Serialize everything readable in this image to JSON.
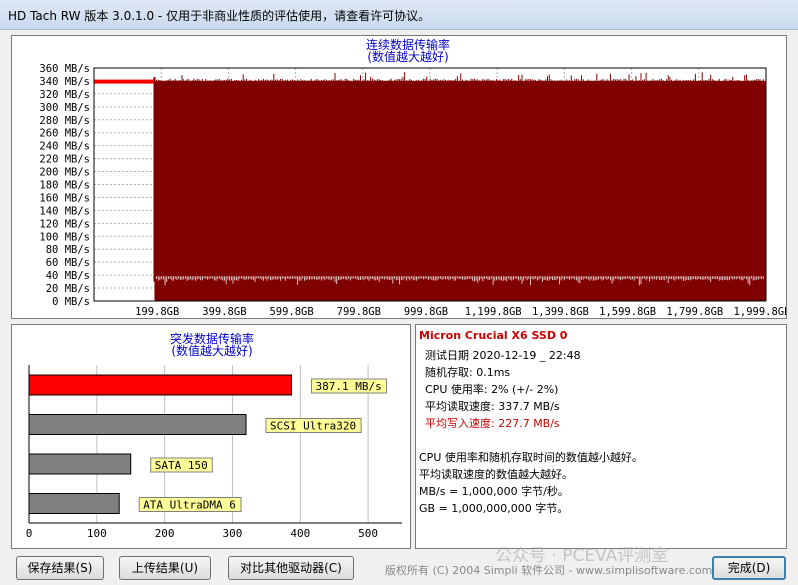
{
  "window": {
    "title": "HD Tach RW 版本 3.0.1.0  - 仅用于非商业性质的评估使用，请查看许可协议。"
  },
  "seq_chart": {
    "title_line1": "连续数据传输率",
    "title_line2": "(数值越大越好)"
  },
  "burst_chart": {
    "title_line1": "突发数据传输率",
    "title_line2": "(数值越大越好)"
  },
  "info": {
    "drive_name": "Micron Crucial X6 SSD 0",
    "test_date": "测试日期 2020-12-19 _ 22:48",
    "random_access": "随机存取: 0.1ms",
    "cpu_usage": "CPU 使用率: 2% (+/- 2%)",
    "avg_read": "平均读取速度: 337.7 MB/s",
    "avg_write": "平均写入速度: 227.7 MB/s",
    "note1": "CPU 使用率和随机存取时间的数值越小越好。",
    "note2": "平均读取速度的数值越大越好。",
    "note3": "MB/s = 1,000,000 字节/秒。",
    "note4": "GB = 1,000,000,000 字节。",
    "write_color": "#cc0000",
    "name_color": "#cc0000"
  },
  "buttons": {
    "save": "保存结果(S)",
    "upload": "上传结果(U)",
    "compare": "对比其他驱动器(C)",
    "done": "完成(D)"
  },
  "footer": {
    "copyright": "版权所有 (C) 2004 Simpli 软件公司 - www.simplisoftware.com",
    "watermark": "公众号 · PCEVA评测室"
  },
  "chart_data": [
    {
      "type": "area",
      "title": "连续数据传输率 (数值越大越好)",
      "x_unit": "GB",
      "y_unit": "MB/s",
      "ylim": [
        0,
        360
      ],
      "xlim": [
        0,
        2000
      ],
      "y_ticks": [
        "0 MB/s",
        "20 MB/s",
        "40 MB/s",
        "60 MB/s",
        "80 MB/s",
        "100 MB/s",
        "120 MB/s",
        "140 MB/s",
        "160 MB/s",
        "180 MB/s",
        "200 MB/s",
        "220 MB/s",
        "240 MB/s",
        "260 MB/s",
        "280 MB/s",
        "300 MB/s",
        "320 MB/s",
        "340 MB/s",
        "360 MB/s"
      ],
      "x_ticks": [
        "199.8GB",
        "399.8GB",
        "599.8GB",
        "799.8GB",
        "999.8GB",
        "1,199.8GB",
        "1,399.8GB",
        "1,599.8GB",
        "1,799.8GB",
        "1,999.8GB"
      ],
      "grid": true,
      "write_fill_color": "#800000",
      "read_line_color": "#ff0000",
      "series": [
        {
          "x_range_gb": [
            0,
            180
          ],
          "value_mbs": 339
        },
        {
          "x_range_gb": [
            180,
            1999.8
          ],
          "value_mbs_max": 340,
          "value_mbs_min": 35
        }
      ]
    },
    {
      "type": "bar",
      "title": "突发数据传输率 (数值越大越好)",
      "orientation": "horizontal",
      "xlim": [
        0,
        550
      ],
      "x_ticks": [
        "0",
        "100",
        "200",
        "300",
        "400",
        "500"
      ],
      "categories": [
        "387.1 MB/s",
        "SCSI Ultra320",
        "SATA 150",
        "ATA UltraDMA 6"
      ],
      "values": [
        387.1,
        320,
        150,
        133
      ],
      "colors": [
        "#ff0000",
        "#808080",
        "#808080",
        "#808080"
      ],
      "label_bg": "#ffff99"
    }
  ]
}
